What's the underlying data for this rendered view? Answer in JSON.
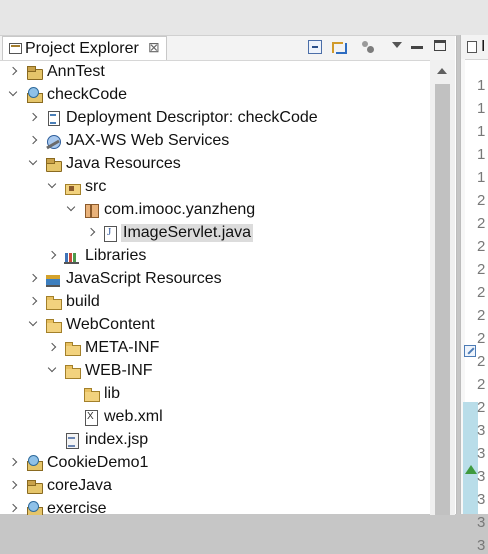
{
  "panel": {
    "title": "Project Explorer",
    "toolbar_icons": [
      "collapse-all-icon",
      "link-with-editor-icon",
      "focus-icon",
      "view-menu-icon",
      "minimize-icon",
      "maximize-icon"
    ]
  },
  "tree": {
    "ann_test": "AnnTest",
    "check_code": "checkCode",
    "deployment_descriptor": "Deployment Descriptor: checkCode",
    "jax_ws": "JAX-WS Web Services",
    "java_resources": "Java Resources",
    "src": "src",
    "package": "com.imooc.yanzheng",
    "image_servlet": "ImageServlet.java",
    "libraries": "Libraries",
    "javascript_resources": "JavaScript Resources",
    "build": "build",
    "web_content": "WebContent",
    "meta_inf": "META-INF",
    "web_inf": "WEB-INF",
    "lib": "lib",
    "web_xml": "web.xml",
    "index_jsp": "index.jsp",
    "cookie_demo": "CookieDemo1",
    "core_java": "coreJava",
    "exercise": "exercise"
  },
  "editor": {
    "tab_label": "I",
    "line_numbers": [
      "1",
      "1",
      "1",
      "1",
      "1",
      "2",
      "2",
      "2",
      "2",
      "2",
      "2",
      "2",
      "2",
      "2",
      "2",
      "3",
      "3",
      "3",
      "3",
      "3",
      "3"
    ]
  }
}
